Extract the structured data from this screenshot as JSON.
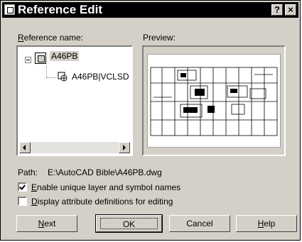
{
  "window": {
    "title": "Reference Edit",
    "help_glyph": "?",
    "close_glyph": "×"
  },
  "reference": {
    "label": "Reference name:",
    "tree": [
      {
        "label": "A46PB",
        "selected": true,
        "icon": "block-reference-icon"
      },
      {
        "label": "A46PB|VCLSD",
        "selected": false,
        "icon": "nested-reference-icon"
      }
    ]
  },
  "preview": {
    "label": "Preview:"
  },
  "path": {
    "label": "Path:",
    "value": "E:\\AutoCAD Bible\\A46PB.dwg"
  },
  "options": [
    {
      "label": "Enable unique layer and symbol names",
      "checked": true
    },
    {
      "label": "Display attribute definitions for editing",
      "checked": false
    }
  ],
  "buttons": {
    "next": "Next",
    "ok": "OK",
    "cancel": "Cancel",
    "help": "Help"
  },
  "colors": {
    "title_bg": "#000000",
    "face": "#d4d0c8",
    "field_bg": "#ffffff"
  }
}
